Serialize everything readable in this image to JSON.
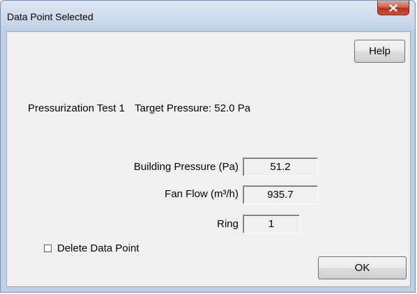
{
  "window": {
    "title": "Data Point Selected"
  },
  "buttons": {
    "help_label": "Help",
    "ok_label": "OK"
  },
  "info": {
    "test_label": "Pressurization Test 1",
    "target_pressure": "Target Pressure: 52.0 Pa"
  },
  "fields": {
    "building_pressure": {
      "label": "Building Pressure (Pa)",
      "value": "51.2"
    },
    "fan_flow": {
      "label": "Fan Flow (m³/h)",
      "value": "935.7"
    },
    "ring": {
      "label": "Ring",
      "value": "1"
    }
  },
  "delete_checkbox": {
    "label": "Delete Data Point",
    "checked": false
  },
  "icons": {
    "close": "close-icon"
  },
  "colors": {
    "titlebar": "#c9d8ea",
    "close_button": "#c9533b",
    "client_background": "#f0f0f0"
  }
}
